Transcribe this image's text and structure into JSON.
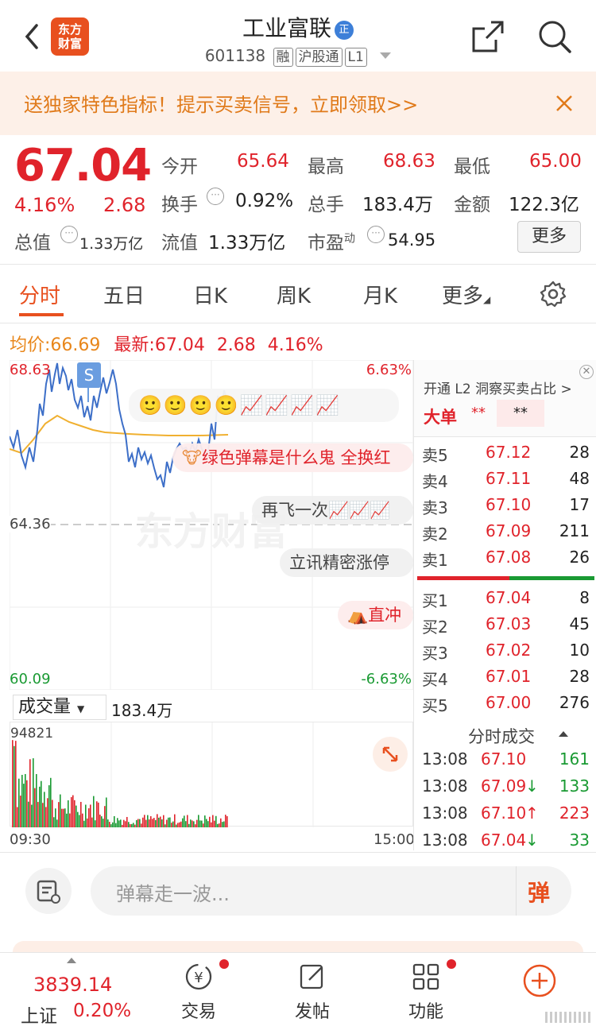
{
  "header": {
    "title": "工业富联",
    "badge": "正",
    "code": "601138",
    "tags": [
      "融",
      "沪股通",
      "L1"
    ],
    "logo_text": "东方财富"
  },
  "banner": {
    "text": "送独家特色指标！提示买卖信号，立即领取>>"
  },
  "quote": {
    "price": "67.04",
    "change_pct": "4.16%",
    "change": "2.68",
    "total_mv_label": "总值",
    "total_mv": "1.33万亿",
    "open_label": "今开",
    "open": "65.64",
    "high_label": "最高",
    "high": "68.63",
    "low_label": "最低",
    "low": "65.00",
    "turnover_label": "换手",
    "turnover": "0.92%",
    "volume_label": "总手",
    "volume": "183.4万",
    "amount_label": "金额",
    "amount": "122.3亿",
    "float_mv_label": "流值",
    "float_mv": "1.33万亿",
    "pe_label": "市盈",
    "pe_sup": "动",
    "pe": "54.95",
    "more_label": "更多"
  },
  "tabs": [
    "分时",
    "五日",
    "日K",
    "周K",
    "月K",
    "更多"
  ],
  "chart": {
    "avg_label": "均价:",
    "avg": "66.69",
    "latest_label": "最新:",
    "latest": "67.04",
    "latest_change": "2.68",
    "latest_pct": "4.16%",
    "y_high": "68.63",
    "y_mid": "64.36",
    "y_low": "60.09",
    "pct_high": "6.63%",
    "pct_low": "-6.63%",
    "s_marker": "S",
    "vol_label": "成交量",
    "vol_value": "183.4万",
    "vol_max": "94821",
    "time_start": "09:30",
    "time_end": "15:00",
    "watermark": "东方财富"
  },
  "danmu": [
    "绿色弹幕是什么鬼 全换红",
    "再飞一次",
    "立讯精密涨停",
    "直冲"
  ],
  "orderbook": {
    "promo": "开通 L2 洞察买卖占比 >",
    "big_label": "大单",
    "big_v1": "**",
    "big_v2": "**",
    "asks": [
      {
        "label": "卖5",
        "price": "67.12",
        "vol": "28"
      },
      {
        "label": "卖4",
        "price": "67.11",
        "vol": "48"
      },
      {
        "label": "卖3",
        "price": "67.10",
        "vol": "17"
      },
      {
        "label": "卖2",
        "price": "67.09",
        "vol": "211"
      },
      {
        "label": "卖1",
        "price": "67.08",
        "vol": "26"
      }
    ],
    "bids": [
      {
        "label": "买1",
        "price": "67.04",
        "vol": "8"
      },
      {
        "label": "买2",
        "price": "67.03",
        "vol": "45"
      },
      {
        "label": "买3",
        "price": "67.02",
        "vol": "10"
      },
      {
        "label": "买4",
        "price": "67.01",
        "vol": "28"
      },
      {
        "label": "买5",
        "price": "67.00",
        "vol": "276"
      }
    ],
    "ticks_title": "分时成交",
    "ticks": [
      {
        "time": "13:08",
        "price": "67.10",
        "arrow": "",
        "vol": "161",
        "color": "green"
      },
      {
        "time": "13:08",
        "price": "67.09",
        "arrow": "↓",
        "vol": "133",
        "color": "green"
      },
      {
        "time": "13:08",
        "price": "67.10",
        "arrow": "↑",
        "vol": "223",
        "color": "red"
      },
      {
        "time": "13:08",
        "price": "67.04",
        "arrow": "↓",
        "vol": "33",
        "color": "green"
      }
    ]
  },
  "input": {
    "placeholder": "弹幕走一波...",
    "send_label": "弹"
  },
  "bottom": {
    "index_value": "3839.14",
    "index_name": "上证",
    "index_pct": "0.20%",
    "items": [
      "交易",
      "发帖",
      "功能"
    ]
  },
  "colors": {
    "up": "#e0232b",
    "down": "#1a9a33",
    "accent": "#e8501f",
    "avg_line": "#f0b030",
    "price_line": "#3d6fc8"
  }
}
